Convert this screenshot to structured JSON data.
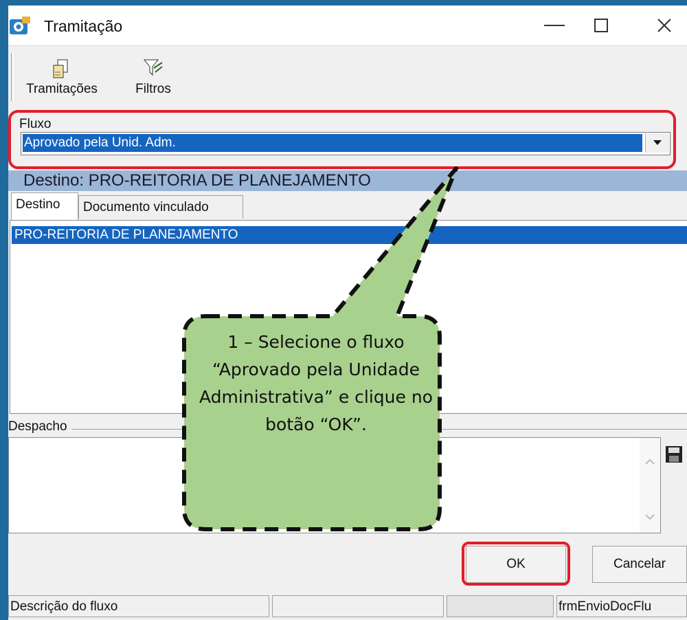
{
  "window": {
    "title": "Tramitação"
  },
  "toolbar": {
    "tramitacoes_label": "Tramitações",
    "filtros_label": "Filtros"
  },
  "fluxo": {
    "label": "Fluxo",
    "selected": "Aprovado pela Unid. Adm."
  },
  "destino_header": "Destino: PRO-REITORIA DE PLANEJAMENTO",
  "tabs": [
    {
      "label": "Destino",
      "active": true
    },
    {
      "label": "Documento vinculado",
      "active": false
    }
  ],
  "destino_list": [
    "PRO-REITORIA DE PLANEJAMENTO"
  ],
  "despacho": {
    "label": "Despacho",
    "value": ""
  },
  "buttons": {
    "ok": "OK",
    "cancelar": "Cancelar"
  },
  "statusbar": {
    "pane1": "Descrição do fluxo",
    "pane2": "",
    "pane3": "",
    "pane4": "frmEnvioDocFlu"
  },
  "callout": {
    "text": "1 – Selecione o fluxo “Aprovado pela Unidade Administrativa” e clique no botão “OK”."
  },
  "colors": {
    "selection": "#1565c0",
    "highlight": "#e11e2a",
    "callout_fill": "#a9d18e",
    "header_bar": "#9bb6d6"
  },
  "icons": {
    "app": "tramitacao-app-icon",
    "tramitacoes": "documents-transfer-icon",
    "filtros": "filter-icon",
    "save": "floppy-disk-icon"
  }
}
